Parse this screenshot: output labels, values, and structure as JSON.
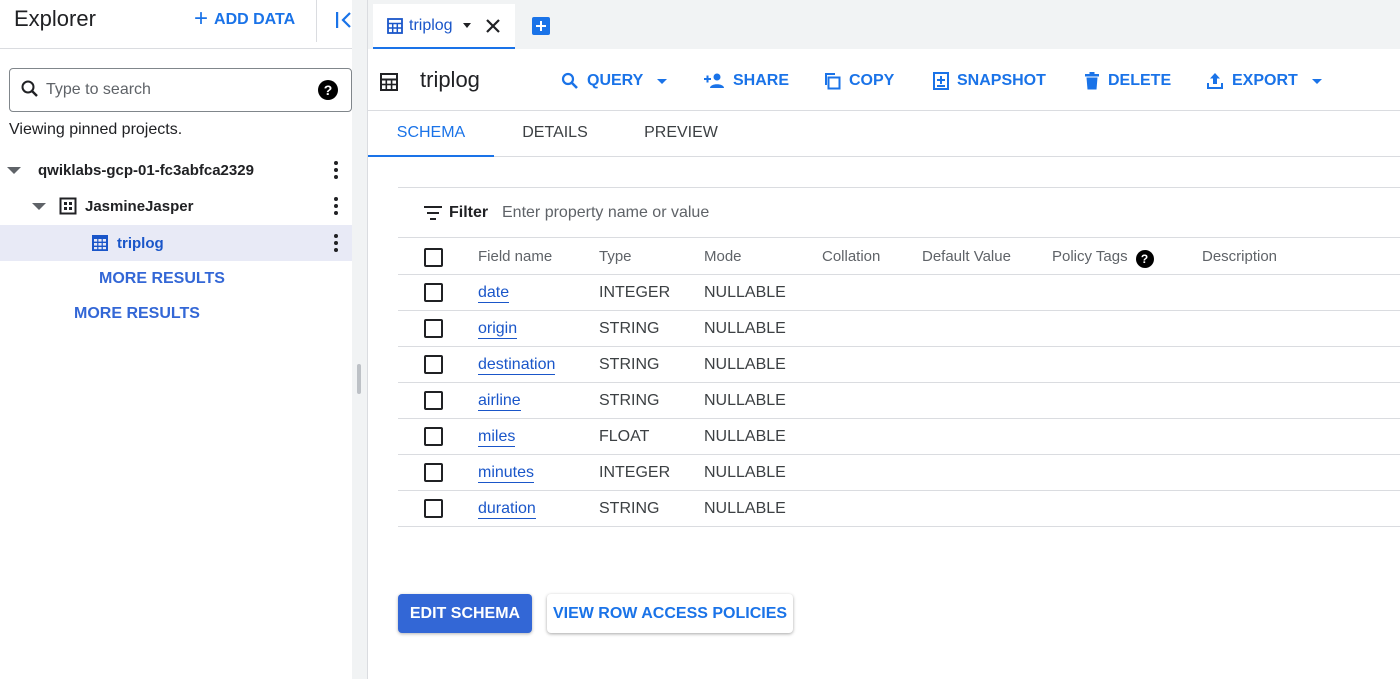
{
  "explorer": {
    "title": "Explorer",
    "add_data_label": "ADD DATA",
    "search_placeholder": "Type to search",
    "pinned_text": "Viewing pinned projects.",
    "tree": {
      "project": "qwiklabs-gcp-01-fc3abfca2329",
      "dataset": "JasmineJasper",
      "table": "triplog",
      "dataset_more_results": "MORE RESULTS",
      "project_more_results": "MORE RESULTS"
    }
  },
  "tabs": [
    {
      "label": "triplog",
      "active": true
    }
  ],
  "toolbar": {
    "title": "triplog",
    "query": "QUERY",
    "share": "SHARE",
    "copy": "COPY",
    "snapshot": "SNAPSHOT",
    "delete": "DELETE",
    "export": "EXPORT"
  },
  "subtabs": {
    "schema": "SCHEMA",
    "details": "DETAILS",
    "preview": "PREVIEW",
    "active": "SCHEMA"
  },
  "schema": {
    "filter_label": "Filter",
    "filter_placeholder": "Enter property name or value",
    "columns": {
      "field_name": "Field name",
      "type": "Type",
      "mode": "Mode",
      "collation": "Collation",
      "default_value": "Default Value",
      "policy_tags": "Policy Tags",
      "description": "Description"
    },
    "rows": [
      {
        "name": "date",
        "type": "INTEGER",
        "mode": "NULLABLE"
      },
      {
        "name": "origin",
        "type": "STRING",
        "mode": "NULLABLE"
      },
      {
        "name": "destination",
        "type": "STRING",
        "mode": "NULLABLE"
      },
      {
        "name": "airline",
        "type": "STRING",
        "mode": "NULLABLE"
      },
      {
        "name": "miles",
        "type": "FLOAT",
        "mode": "NULLABLE"
      },
      {
        "name": "minutes",
        "type": "INTEGER",
        "mode": "NULLABLE"
      },
      {
        "name": "duration",
        "type": "STRING",
        "mode": "NULLABLE"
      }
    ],
    "edit_schema": "EDIT SCHEMA",
    "view_row_access": "VIEW ROW ACCESS POLICIES"
  },
  "colors": {
    "accent": "#1a73e8",
    "primary_button": "#3367d6",
    "selected_row": "#e8eaf6"
  }
}
